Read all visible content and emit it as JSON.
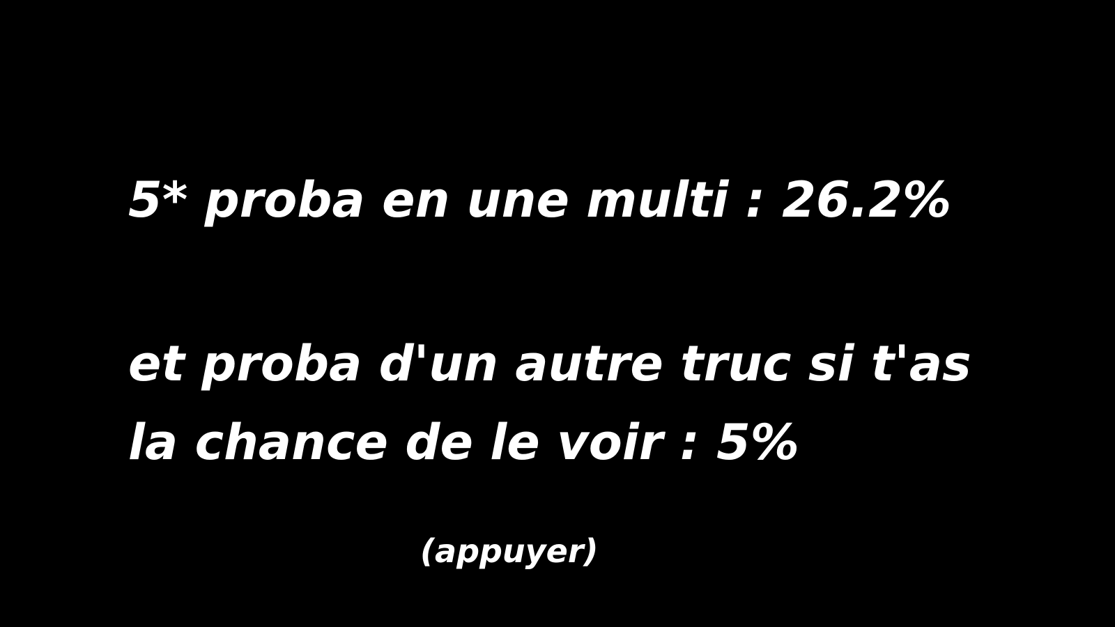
{
  "slide": {
    "line1": "5* proba en une multi : 26.2%",
    "line2": "et proba d'un autre truc si t'as",
    "line3": "la chance de le voir : 5%",
    "hint": "(appuyer)",
    "background_color": "#000000",
    "text_color": "#ffffff"
  }
}
